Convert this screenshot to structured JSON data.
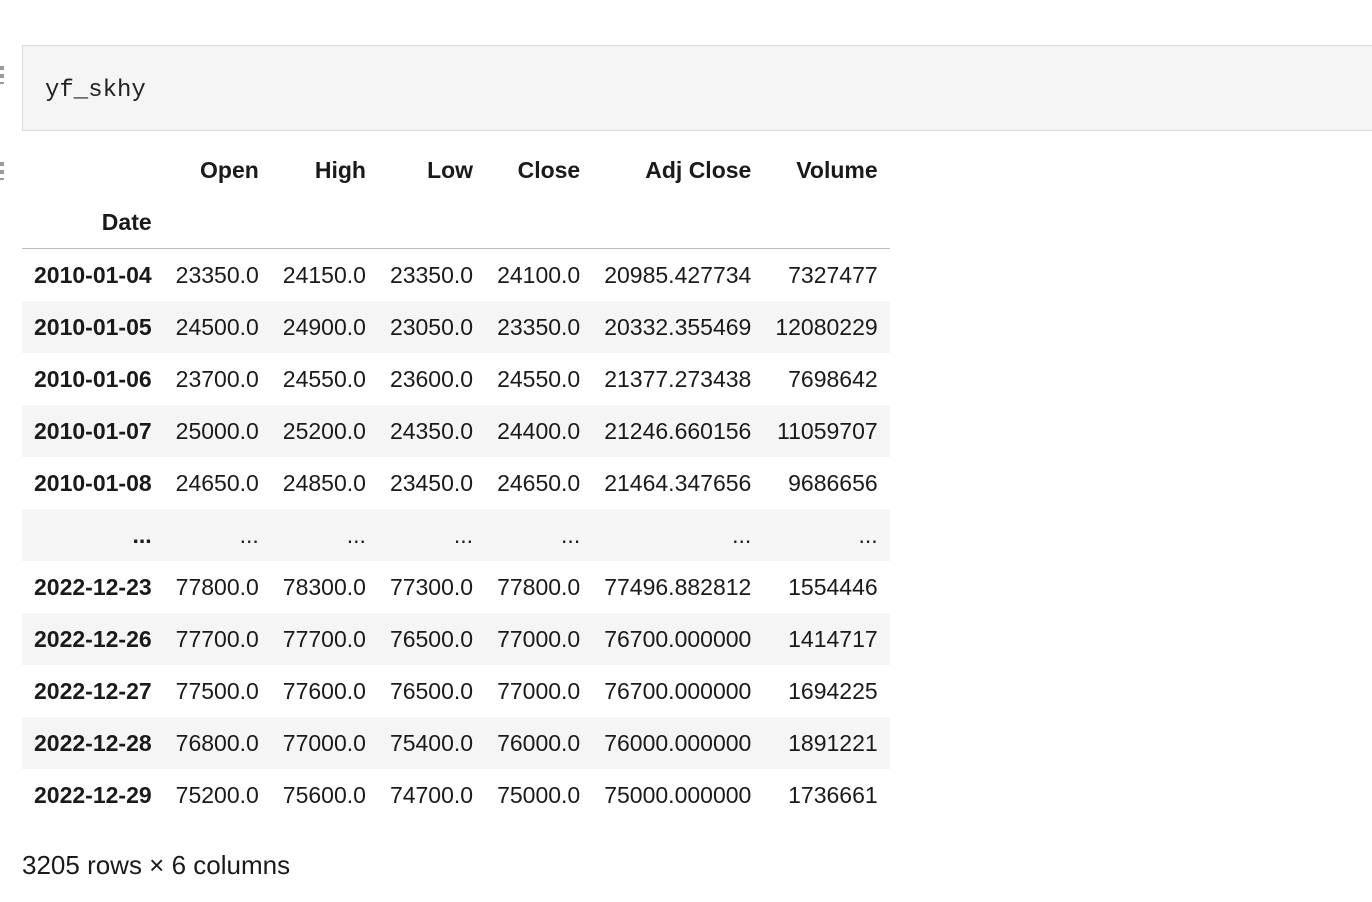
{
  "cell": {
    "code": "yf_skhy"
  },
  "dataframe": {
    "columns": [
      "Open",
      "High",
      "Low",
      "Close",
      "Adj Close",
      "Volume"
    ],
    "index_name": "Date",
    "rows": [
      {
        "date": "2010-01-04",
        "values": [
          "23350.0",
          "24150.0",
          "23350.0",
          "24100.0",
          "20985.427734",
          "7327477"
        ]
      },
      {
        "date": "2010-01-05",
        "values": [
          "24500.0",
          "24900.0",
          "23050.0",
          "23350.0",
          "20332.355469",
          "12080229"
        ]
      },
      {
        "date": "2010-01-06",
        "values": [
          "23700.0",
          "24550.0",
          "23600.0",
          "24550.0",
          "21377.273438",
          "7698642"
        ]
      },
      {
        "date": "2010-01-07",
        "values": [
          "25000.0",
          "25200.0",
          "24350.0",
          "24400.0",
          "21246.660156",
          "11059707"
        ]
      },
      {
        "date": "2010-01-08",
        "values": [
          "24650.0",
          "24850.0",
          "23450.0",
          "24650.0",
          "21464.347656",
          "9686656"
        ]
      },
      {
        "date": "...",
        "values": [
          "...",
          "...",
          "...",
          "...",
          "...",
          "..."
        ]
      },
      {
        "date": "2022-12-23",
        "values": [
          "77800.0",
          "78300.0",
          "77300.0",
          "77800.0",
          "77496.882812",
          "1554446"
        ]
      },
      {
        "date": "2022-12-26",
        "values": [
          "77700.0",
          "77700.0",
          "76500.0",
          "77000.0",
          "76700.000000",
          "1414717"
        ]
      },
      {
        "date": "2022-12-27",
        "values": [
          "77500.0",
          "77600.0",
          "76500.0",
          "77000.0",
          "76700.000000",
          "1694225"
        ]
      },
      {
        "date": "2022-12-28",
        "values": [
          "76800.0",
          "77000.0",
          "75400.0",
          "76000.0",
          "76000.000000",
          "1891221"
        ]
      },
      {
        "date": "2022-12-29",
        "values": [
          "75200.0",
          "75600.0",
          "74700.0",
          "75000.0",
          "75000.000000",
          "1736661"
        ]
      }
    ],
    "shape_text": "3205 rows × 6 columns"
  }
}
